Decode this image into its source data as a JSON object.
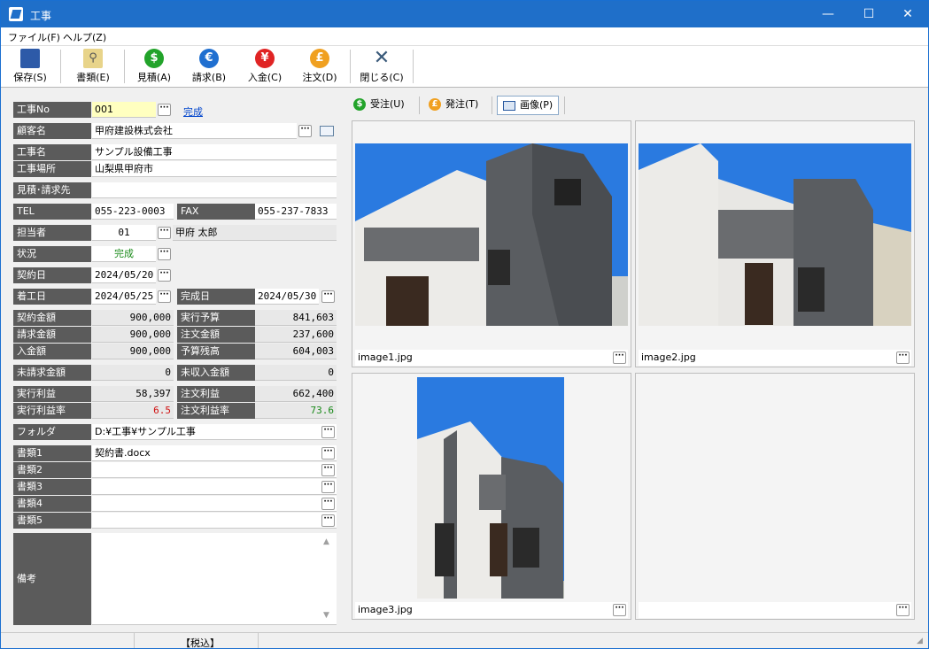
{
  "window": {
    "title": "工事",
    "minimize": "—",
    "maximize": "☐",
    "close": "✕"
  },
  "menu": {
    "file": "ファイル(F)",
    "help": "ヘルプ(Z)"
  },
  "toolbar": {
    "save": "保存(S)",
    "docs": "書類(E)",
    "estimate": "見積(A)",
    "invoice": "請求(B)",
    "payment": "入金(C)",
    "order": "注文(D)",
    "close": "閉じる(C)",
    "icons": {
      "estimate": "$",
      "invoice": "€",
      "payment": "¥",
      "order": "£"
    },
    "colors": {
      "estimate": "#22a32a",
      "invoice": "#1f6fd0",
      "payment": "#e02424",
      "order": "#f0a020"
    }
  },
  "form": {
    "job_no": {
      "label": "工事No",
      "value": "001",
      "status_link": "完成"
    },
    "customer": {
      "label": "顧客名",
      "value": "甲府建設株式会社"
    },
    "job_name": {
      "label": "工事名",
      "value": "サンプル設備工事"
    },
    "location": {
      "label": "工事場所",
      "value": "山梨県甲府市"
    },
    "billing_to": {
      "label": "見積･請求先",
      "value": ""
    },
    "tel": {
      "label": "TEL",
      "value": "055-223-0003"
    },
    "fax": {
      "label": "FAX",
      "value": "055-237-7833"
    },
    "staff": {
      "label": "担当者",
      "code": "01",
      "name": "甲府 太郎"
    },
    "status": {
      "label": "状況",
      "value": "完成"
    },
    "contract_date": {
      "label": "契約日",
      "value": "2024/05/20"
    },
    "start_date": {
      "label": "着工日",
      "value": "2024/05/25"
    },
    "complete_date": {
      "label": "完成日",
      "value": "2024/05/30"
    },
    "contract_amount": {
      "label": "契約金額",
      "value": "900,000"
    },
    "exec_budget": {
      "label": "実行予算",
      "value": "841,603"
    },
    "billed_amount": {
      "label": "請求金額",
      "value": "900,000"
    },
    "order_amount": {
      "label": "注文金額",
      "value": "237,600"
    },
    "paid_amount": {
      "label": "入金額",
      "value": "900,000"
    },
    "budget_remaining": {
      "label": "予算残高",
      "value": "604,003"
    },
    "unbilled": {
      "label": "未請求金額",
      "value": "0"
    },
    "unreceived": {
      "label": "未収入金額",
      "value": "0"
    },
    "exec_profit": {
      "label": "実行利益",
      "value": "58,397"
    },
    "order_profit": {
      "label": "注文利益",
      "value": "662,400"
    },
    "exec_profit_rate": {
      "label": "実行利益率",
      "value": "6.5"
    },
    "order_profit_rate": {
      "label": "注文利益率",
      "value": "73.6"
    },
    "folder": {
      "label": "フォルダ",
      "value": "D:¥工事¥サンプル工事"
    },
    "docs": [
      {
        "label": "書類1",
        "value": "契約書.docx"
      },
      {
        "label": "書類2",
        "value": ""
      },
      {
        "label": "書類3",
        "value": ""
      },
      {
        "label": "書類4",
        "value": ""
      },
      {
        "label": "書類5",
        "value": ""
      }
    ],
    "notes": {
      "label": "備考",
      "value": ""
    }
  },
  "tabs": {
    "received": "受注(U)",
    "placed": "発注(T)",
    "images": "画像(P)"
  },
  "images": [
    {
      "caption": "image1.jpg"
    },
    {
      "caption": "image2.jpg"
    },
    {
      "caption": "image3.jpg"
    },
    {
      "caption": ""
    }
  ],
  "ellipsis": "···",
  "status_bar": {
    "tax": "【税込】"
  }
}
